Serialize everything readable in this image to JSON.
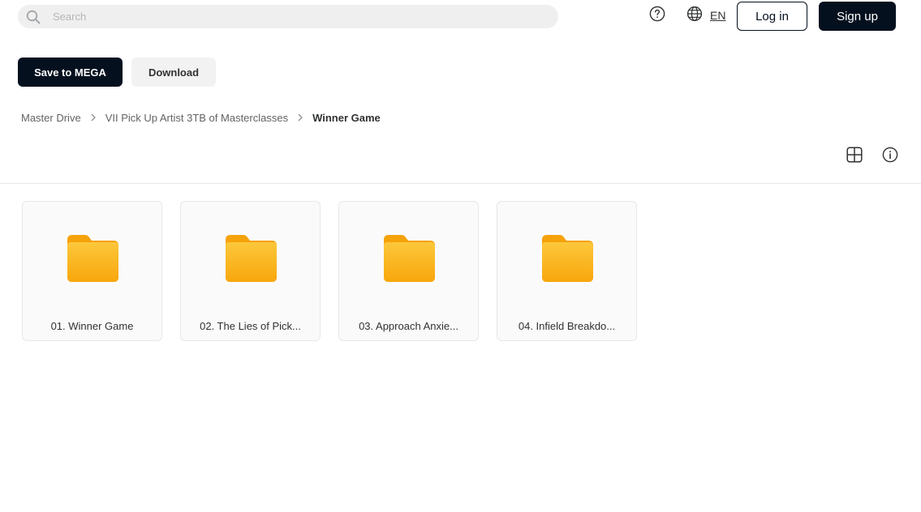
{
  "header": {
    "search": {
      "placeholder": "Search",
      "value": ""
    },
    "language": "EN",
    "login_label": "Log in",
    "signup_label": "Sign up"
  },
  "actions": {
    "save_label": "Save to MEGA",
    "download_label": "Download"
  },
  "breadcrumb": {
    "items": [
      "Master Drive",
      "VII Pick Up Artist 3TB of Masterclasses"
    ],
    "current": "Winner Game"
  },
  "folders": [
    {
      "name": "01. Winner Game"
    },
    {
      "name": "02. The Lies of Pick..."
    },
    {
      "name": "03. Approach Anxie..."
    },
    {
      "name": "04. Infield Breakdo..."
    }
  ],
  "colors": {
    "primary_dark": "#04101e",
    "folder_yellow": "#fbbf24",
    "folder_orange": "#f59e0b"
  },
  "icons": [
    "search-icon",
    "help-icon",
    "globe-icon",
    "chevron-right-icon",
    "grid-view-icon",
    "info-icon",
    "folder-icon"
  ]
}
